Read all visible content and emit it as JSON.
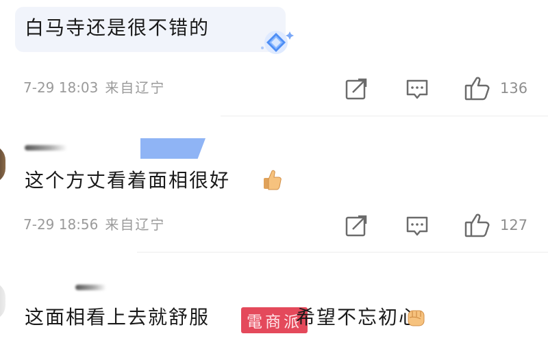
{
  "comments": [
    {
      "text": "白马寺还是很不错的",
      "date": "7-29 18:03",
      "location": "来自辽宁",
      "likes": "136",
      "badge_icon": "diamond-badge-icon"
    },
    {
      "text": "这个方丈看着面相很好",
      "emoji_icon": "thumbs-up-emoji",
      "date": "7-29 18:56",
      "location": "来自辽宁",
      "likes": "127"
    },
    {
      "text": "这面相看上去就舒服",
      "text_after": "希望不忘初心",
      "emoji_icon": "fist-emoji"
    }
  ],
  "watermark": "電商派",
  "actions": {
    "share_icon": "share-icon",
    "reply_icon": "reply-icon",
    "like_icon": "thumbs-up-icon"
  },
  "colors": {
    "accent_blue": "#8fb4f5",
    "bubble_bg": "#f1f4fb",
    "watermark_red": "#e23a4e",
    "meta_gray": "#9a9a9a"
  }
}
